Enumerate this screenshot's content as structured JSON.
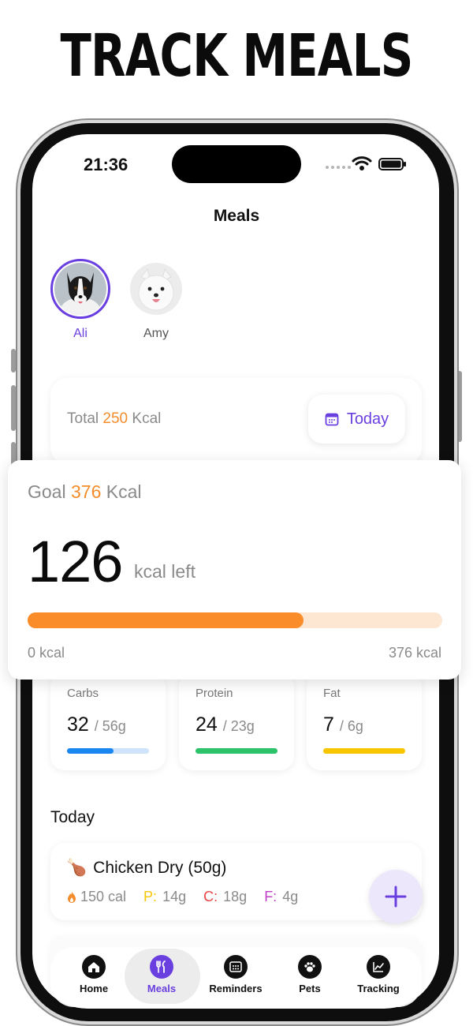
{
  "headline": "TRACK MEALS",
  "status": {
    "time": "21:36"
  },
  "title": "Meals",
  "pets": [
    {
      "name": "Ali",
      "selected": true
    },
    {
      "name": "Amy",
      "selected": false
    }
  ],
  "total": {
    "prefix": "Total",
    "value": "250",
    "unit": "Kcal"
  },
  "date_button": {
    "label": "Today",
    "icon": "calendar-icon"
  },
  "goal": {
    "prefix": "Goal",
    "value": "376",
    "unit": "Kcal",
    "remaining": "126",
    "remaining_label": "kcal left",
    "progress_fraction": 0.665,
    "range_min": "0 kcal",
    "range_max": "376 kcal"
  },
  "macros": [
    {
      "label": "Carbs",
      "value": "32",
      "goal": "/ 56g",
      "fraction": 0.57,
      "color": "#1a86f0",
      "track": "#cfe4fb"
    },
    {
      "label": "Protein",
      "value": "24",
      "goal": "/ 23g",
      "fraction": 1.0,
      "color": "#2cc36b",
      "track": "#d2f1df"
    },
    {
      "label": "Fat",
      "value": "7",
      "goal": "/ 6g",
      "fraction": 1.0,
      "color": "#f7c600",
      "track": "#fdf0bf"
    }
  ],
  "section_title": "Today",
  "meals": [
    {
      "emoji": "🍗",
      "name": "Chicken Dry (50g)",
      "calories": "150 cal",
      "protein_key": "P:",
      "protein": "14g",
      "carbs_key": "C:",
      "carbs": "18g",
      "fat_key": "F:",
      "fat": "4g"
    }
  ],
  "tabs": [
    {
      "label": "Home",
      "icon": "house-icon",
      "active": false
    },
    {
      "label": "Meals",
      "icon": "fork-knife-icon",
      "active": true
    },
    {
      "label": "Reminders",
      "icon": "calendar-grid-icon",
      "active": false
    },
    {
      "label": "Pets",
      "icon": "paw-icon",
      "active": false
    },
    {
      "label": "Tracking",
      "icon": "chart-icon",
      "active": false
    }
  ],
  "colors": {
    "accent": "#6a3fe0",
    "orange": "#f48c2c",
    "progress": "#fb8c2a",
    "progress_track": "#fde6d2"
  }
}
